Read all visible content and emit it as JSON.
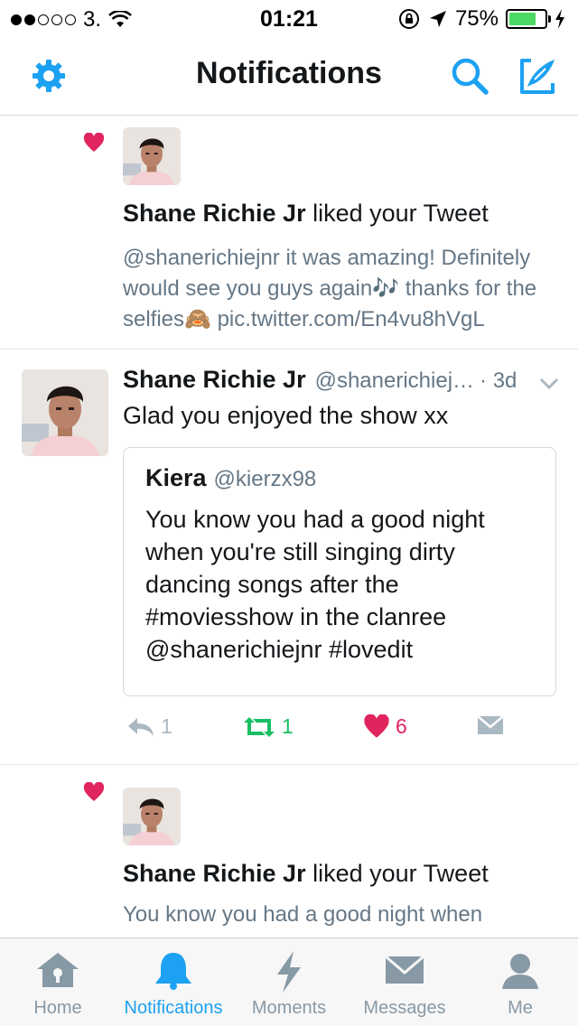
{
  "status_bar": {
    "carrier": "3.",
    "time": "01:21",
    "battery_percent": "75%",
    "battery_level": 0.75,
    "signal_bars_filled": 2,
    "signal_bars_total": 5
  },
  "header": {
    "title": "Notifications",
    "accent_color": "#1da1f2"
  },
  "notifications": [
    {
      "type": "like",
      "actor": "Shane Richie Jr",
      "action": "liked your Tweet",
      "snippet": "@shanerichiejnr it was amazing! Definitely would see you guys again🎶 thanks for the selfies🙈 pic.twitter.com/En4vu8hVgL"
    },
    {
      "type": "tweet",
      "author_name": "Shane Richie Jr",
      "author_handle": "@shanerichiej…",
      "timestamp": "· 3d",
      "text": "Glad you enjoyed the show xx",
      "quoted": {
        "name": "Kiera",
        "handle": "@kierzx98",
        "text": "You know you had a good night when you're still singing dirty dancing songs after the #moviesshow in the clanree @shanerichiejnr #lovedit"
      },
      "actions": {
        "reply_count": "1",
        "retweet_count": "1",
        "like_count": "6"
      }
    },
    {
      "type": "like",
      "actor": "Shane Richie Jr",
      "action": "liked your Tweet",
      "snippet": "You know you had a good night when"
    }
  ],
  "tab_bar": {
    "tabs": [
      {
        "label": "Home",
        "icon": "home-icon",
        "active": false
      },
      {
        "label": "Notifications",
        "icon": "bell-icon",
        "active": true
      },
      {
        "label": "Moments",
        "icon": "lightning-icon",
        "active": false
      },
      {
        "label": "Messages",
        "icon": "envelope-icon",
        "active": false
      },
      {
        "label": "Me",
        "icon": "person-icon",
        "active": false
      }
    ]
  }
}
